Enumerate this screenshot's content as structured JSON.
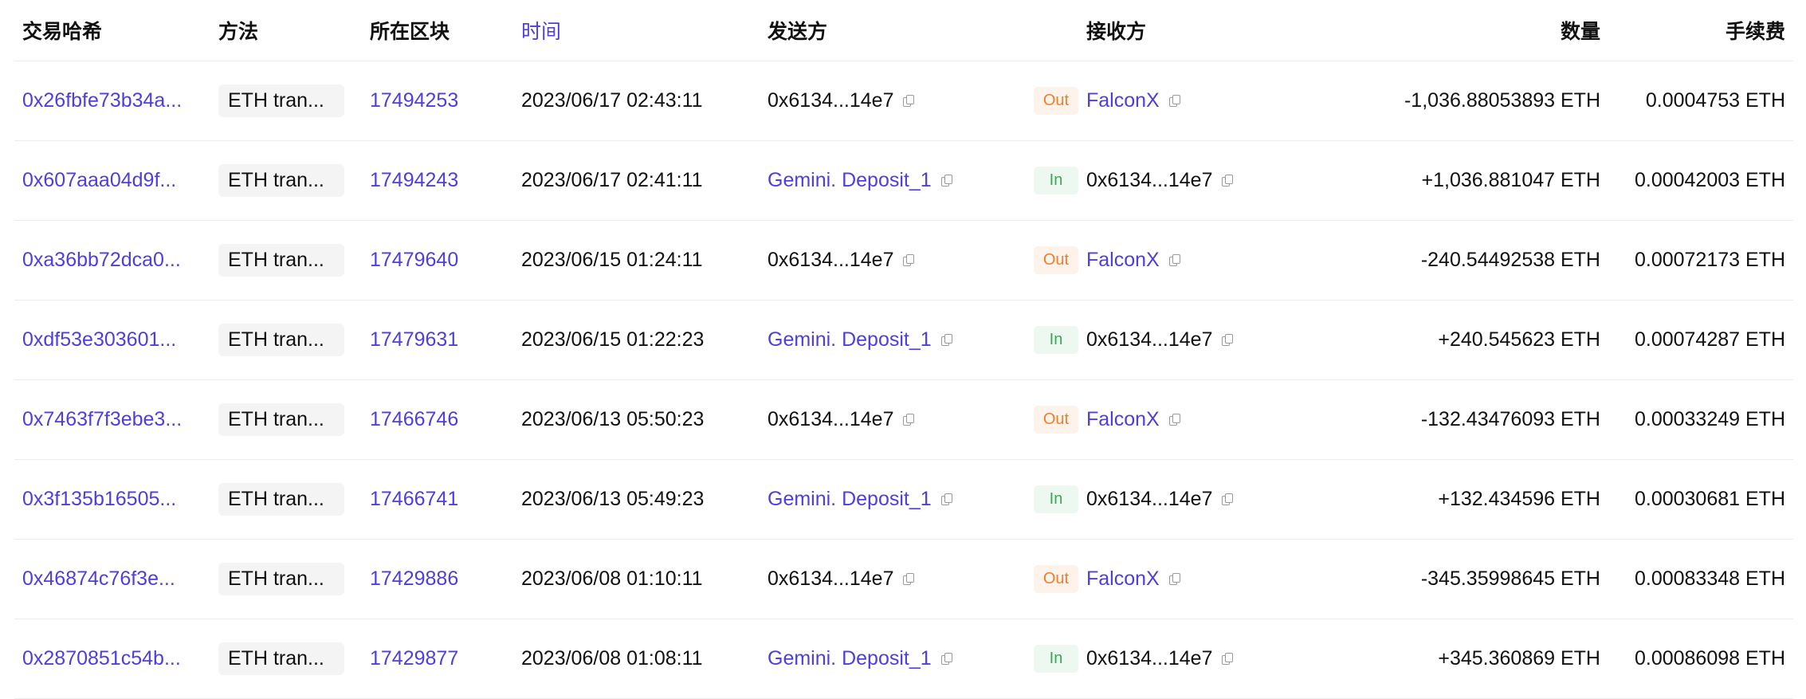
{
  "columns": {
    "hash": "交易哈希",
    "method": "方法",
    "block": "所在区块",
    "time": "时间",
    "from": "发送方",
    "to": "接收方",
    "amount": "数量",
    "fee": "手续费"
  },
  "colors": {
    "link": "#4e3ee0",
    "out": "#f07d2e",
    "in": "#3aa657"
  },
  "rows": [
    {
      "hash": "0x26fbfe73b34a...",
      "method": "ETH tran...",
      "block": "17494253",
      "time": "2023/06/17 02:43:11",
      "from": "0x6134...14e7",
      "direction": "Out",
      "to": "FalconX",
      "amount": "-1,036.88053893 ETH",
      "fee": "0.0004753 ETH"
    },
    {
      "hash": "0x607aaa04d9f...",
      "method": "ETH tran...",
      "block": "17494243",
      "time": "2023/06/17 02:41:11",
      "from": "Gemini. Deposit_1",
      "direction": "In",
      "to": "0x6134...14e7",
      "amount": "+1,036.881047 ETH",
      "fee": "0.00042003 ETH"
    },
    {
      "hash": "0xa36bb72dca0...",
      "method": "ETH tran...",
      "block": "17479640",
      "time": "2023/06/15 01:24:11",
      "from": "0x6134...14e7",
      "direction": "Out",
      "to": "FalconX",
      "amount": "-240.54492538 ETH",
      "fee": "0.00072173 ETH"
    },
    {
      "hash": "0xdf53e303601...",
      "method": "ETH tran...",
      "block": "17479631",
      "time": "2023/06/15 01:22:23",
      "from": "Gemini. Deposit_1",
      "direction": "In",
      "to": "0x6134...14e7",
      "amount": "+240.545623 ETH",
      "fee": "0.00074287 ETH"
    },
    {
      "hash": "0x7463f7f3ebe3...",
      "method": "ETH tran...",
      "block": "17466746",
      "time": "2023/06/13 05:50:23",
      "from": "0x6134...14e7",
      "direction": "Out",
      "to": "FalconX",
      "amount": "-132.43476093 ETH",
      "fee": "0.00033249 ETH"
    },
    {
      "hash": "0x3f135b16505...",
      "method": "ETH tran...",
      "block": "17466741",
      "time": "2023/06/13 05:49:23",
      "from": "Gemini. Deposit_1",
      "direction": "In",
      "to": "0x6134...14e7",
      "amount": "+132.434596 ETH",
      "fee": "0.00030681 ETH"
    },
    {
      "hash": "0x46874c76f3e...",
      "method": "ETH tran...",
      "block": "17429886",
      "time": "2023/06/08 01:10:11",
      "from": "0x6134...14e7",
      "direction": "Out",
      "to": "FalconX",
      "amount": "-345.35998645 ETH",
      "fee": "0.00083348 ETH"
    },
    {
      "hash": "0x2870851c54b...",
      "method": "ETH tran...",
      "block": "17429877",
      "time": "2023/06/08 01:08:11",
      "from": "Gemini. Deposit_1",
      "direction": "In",
      "to": "0x6134...14e7",
      "amount": "+345.360869 ETH",
      "fee": "0.00086098 ETH"
    }
  ]
}
